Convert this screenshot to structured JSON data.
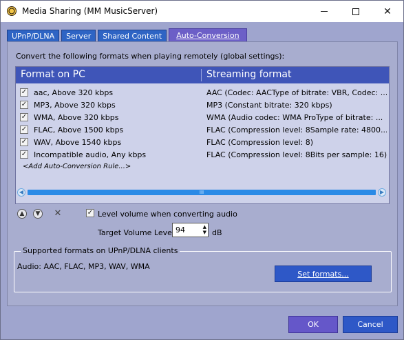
{
  "window": {
    "title": "Media Sharing (MM MusicServer)"
  },
  "tabs": [
    {
      "label": "UPnP/DLNA",
      "active": false
    },
    {
      "label": "Server",
      "active": false
    },
    {
      "label": "Shared Content",
      "active": false
    },
    {
      "label": "Auto-Conversion",
      "active": true
    }
  ],
  "instruction": "Convert the following formats when playing remotely (global settings):",
  "grid": {
    "columns": [
      "Format on PC",
      "Streaming format"
    ],
    "rows": [
      {
        "checked": true,
        "format": "aac, Above 320 kbps",
        "streaming": "AAC (Codec: AACType of bitrate: VBR, Codec: ..."
      },
      {
        "checked": true,
        "format": "MP3, Above 320 kbps",
        "streaming": "MP3 (Constant bitrate: 320 kbps)"
      },
      {
        "checked": true,
        "format": "WMA, Above 320 kbps",
        "streaming": "WMA (Audio codec: WMA ProType of bitrate: ..."
      },
      {
        "checked": true,
        "format": "FLAC, Above 1500 kbps",
        "streaming": "FLAC (Compression level: 8Sample rate: 4800..."
      },
      {
        "checked": true,
        "format": "WAV, Above 1540 kbps",
        "streaming": "FLAC (Compression level: 8)"
      },
      {
        "checked": true,
        "format": "Incompatible audio, Any kbps",
        "streaming": "FLAC (Compression level: 8Bits per sample: 16)"
      }
    ],
    "add_rule": "<Add Auto-Conversion Rule...>",
    "scroll_grip": "III"
  },
  "controls": {
    "level_volume_label": "Level volume when converting audio",
    "level_volume_checked": true,
    "target_volume_label": "Target Volume Level:",
    "target_volume_value": "94",
    "target_volume_unit": "dB"
  },
  "supported": {
    "title": "Supported formats on UPnP/DLNA clients",
    "audio": "Audio: AAC, FLAC, MP3, WAV, WMA",
    "set_formats_label": "Set formats..."
  },
  "footer": {
    "ok_label": "OK",
    "cancel_label": "Cancel"
  },
  "colors": {
    "panel": "#a8adcf",
    "header": "#3f55b8",
    "button_blue": "#2e58c7",
    "button_purple": "#6557c9"
  }
}
